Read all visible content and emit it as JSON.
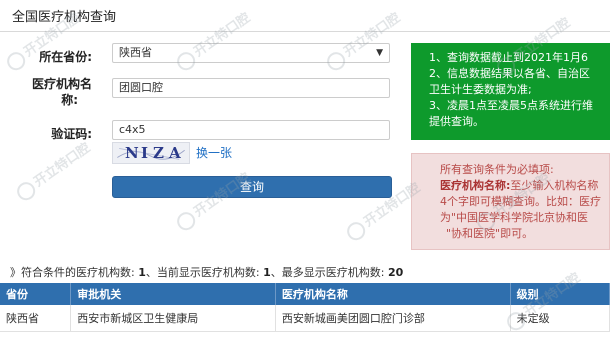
{
  "page": {
    "title": "全国医疗机构查询"
  },
  "form": {
    "province_label": "所在省份:",
    "province_value": "陕西省",
    "institution_label_line1": "医疗机构名",
    "institution_label_line2": "称:",
    "institution_value": "团圆口腔",
    "captcha_label": "验证码:",
    "captcha_value": "c4x5",
    "captcha_image_chars": [
      "N",
      "I",
      "Z",
      "A"
    ],
    "refresh_link": "换一张",
    "query_button": "查询"
  },
  "info": {
    "line1": "1、查询数据截止到2021年1月6",
    "line2": "2、信息数据结果以各省、自治区",
    "line2b": "卫生计生委数据为准;",
    "line3": "3、凌晨1点至凌晨5点系统进行维",
    "line3b": "提供查询。"
  },
  "notice": {
    "line1": "所有查询条件为必填项:",
    "line2_bold": "医疗机构名称:",
    "line2_rest": "至少输入机构名称",
    "line3": "4个字即可模糊查询。比如：医疗",
    "line4": "为\"中国医学科学院北京协和医",
    "line5": "\"协和医院\"即可。"
  },
  "summary": {
    "prefix": "》符合条件的医疗机构数:",
    "matched": "1",
    "sep1": "、当前显示医疗机构数:",
    "shown": "1",
    "sep2": "、最多显示医疗机构数:",
    "max": "20"
  },
  "table": {
    "headers": [
      "省份",
      "审批机关",
      "医疗机构名称",
      "级别"
    ],
    "rows": [
      [
        "陕西省",
        "西安市新城区卫生健康局",
        "西安新城画美团圆口腔门诊部",
        "未定级"
      ]
    ]
  },
  "watermark": {
    "text": "开立特口腔"
  },
  "colors": {
    "primary": "#2f6fae",
    "info_green": "#0e9a2c",
    "notice_bg": "#f2dede",
    "notice_text": "#b84a48"
  }
}
